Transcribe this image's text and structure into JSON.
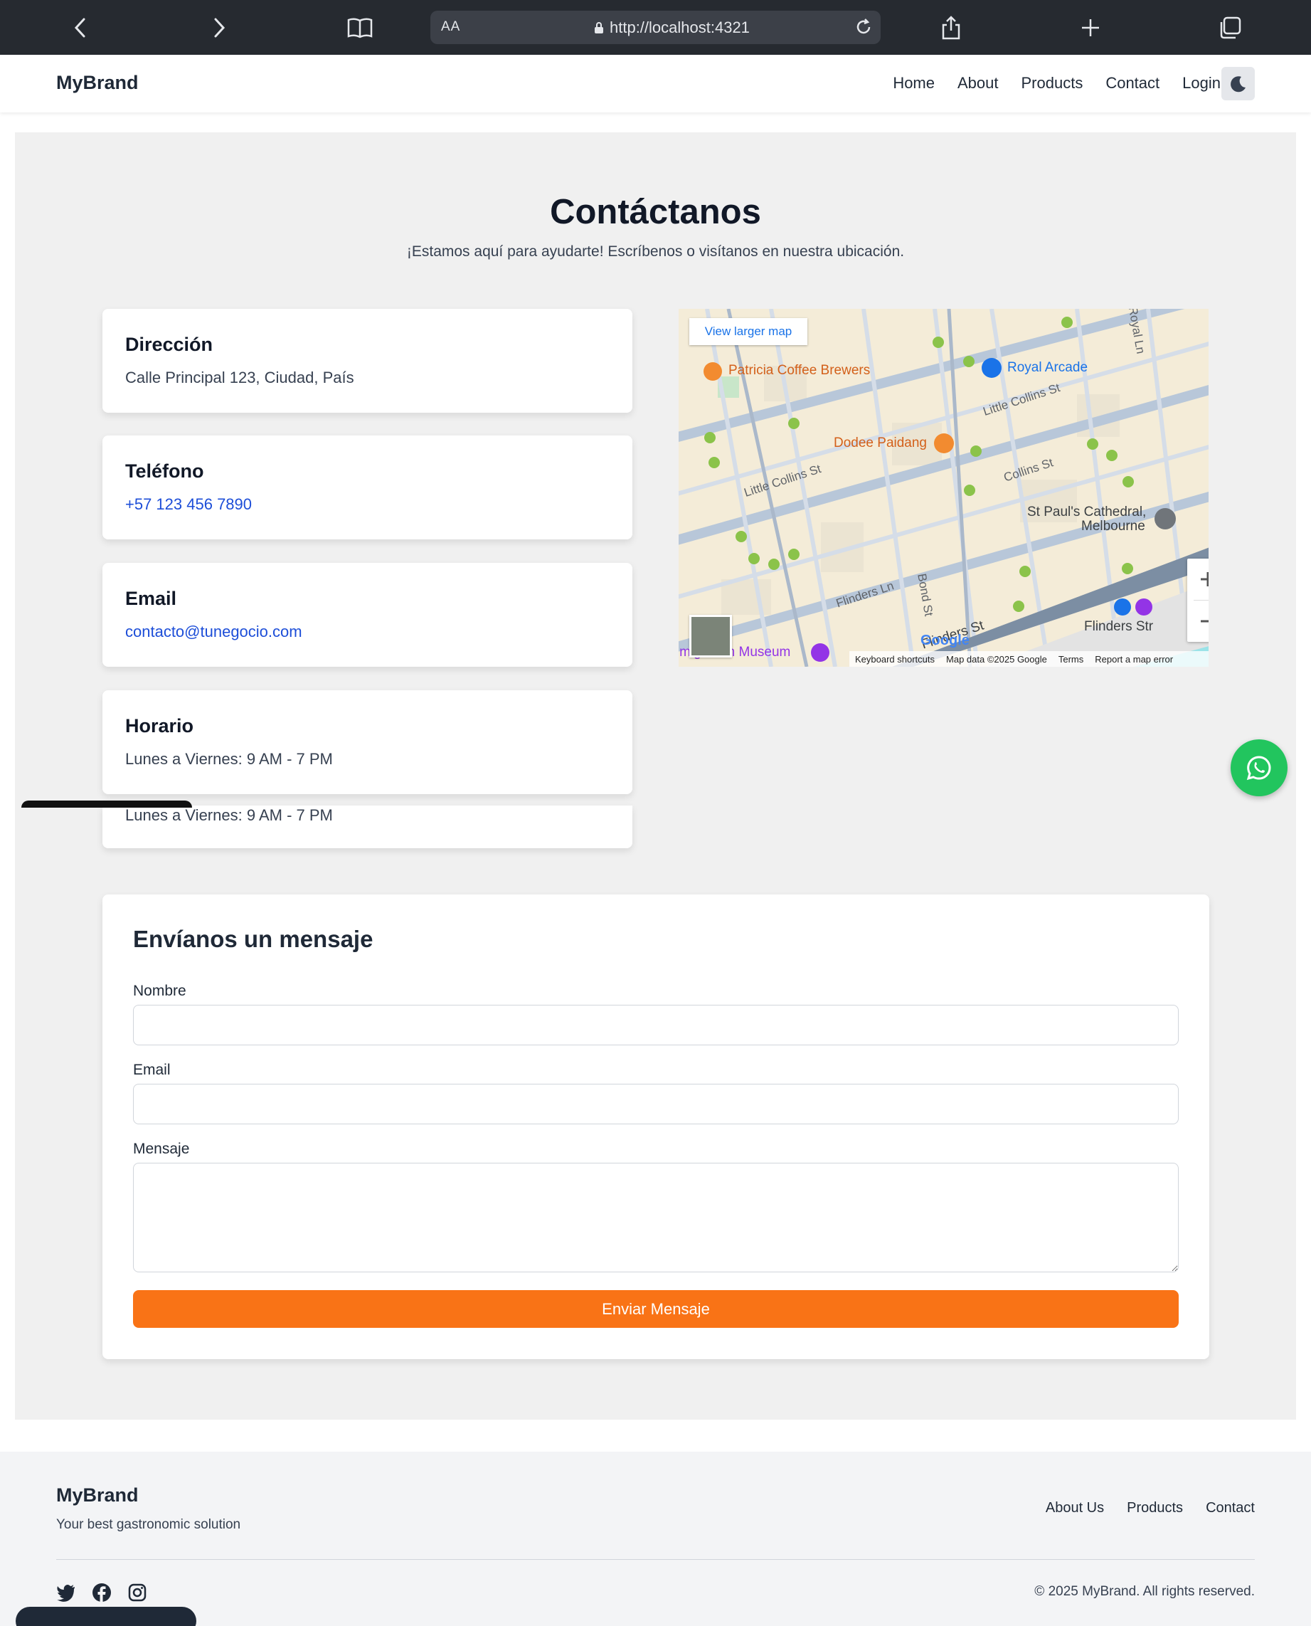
{
  "browser": {
    "url": "http://localhost:4321",
    "text_size_label": "AA"
  },
  "nav": {
    "brand": "MyBrand",
    "links": [
      "Home",
      "About",
      "Products",
      "Contact",
      "Login"
    ]
  },
  "contact": {
    "title": "Contáctanos",
    "subtitle": "¡Estamos aquí para ayudarte! Escríbenos o visítanos en nuestra ubicación.",
    "cards": [
      {
        "title": "Dirección",
        "value": "Calle Principal 123, Ciudad, País"
      },
      {
        "title": "Teléfono",
        "value": "+57 123 456 7890"
      },
      {
        "title": "Email",
        "value": "contacto@tunegocio.com"
      },
      {
        "title": "Horario",
        "value": "Lunes a Viernes: 9 AM - 7 PM"
      }
    ],
    "ghost_value": "Lunes a Viernes: 9 AM - 7 PM"
  },
  "map": {
    "view_larger": "View larger map",
    "labels": {
      "patricia": "Patricia Coffee Brewers",
      "royal_arcade": "Royal Arcade",
      "dodee": "Dodee Paidang",
      "little_collins_1": "Little Collins St",
      "little_collins_2": "Little Collins St",
      "collins": "Collins St",
      "st_pauls": "St Paul's Cathedral,",
      "melbourne": "Melbourne",
      "flinders_ln": "Flinders Ln",
      "bond_st": "Bond St",
      "flinders_st": "Flinders St",
      "flinders_str": "Flinders Str",
      "museum": "Immigration Museum",
      "royal_ln": "Royal Ln",
      "google": "Google"
    },
    "attribution": [
      "Keyboard shortcuts",
      "Map data ©2025 Google",
      "Terms",
      "Report a map error"
    ]
  },
  "form": {
    "title": "Envíanos un mensaje",
    "name_label": "Nombre",
    "email_label": "Email",
    "message_label": "Mensaje",
    "submit_label": "Enviar Mensaje"
  },
  "footer": {
    "brand": "MyBrand",
    "tagline": "Your best gastronomic solution",
    "links": [
      "About Us",
      "Products",
      "Contact"
    ],
    "copyright": "© 2025 MyBrand. All rights reserved."
  },
  "colors": {
    "accent": "#f97316",
    "whatsapp": "#22c55e",
    "link": "#1d4ed8"
  }
}
